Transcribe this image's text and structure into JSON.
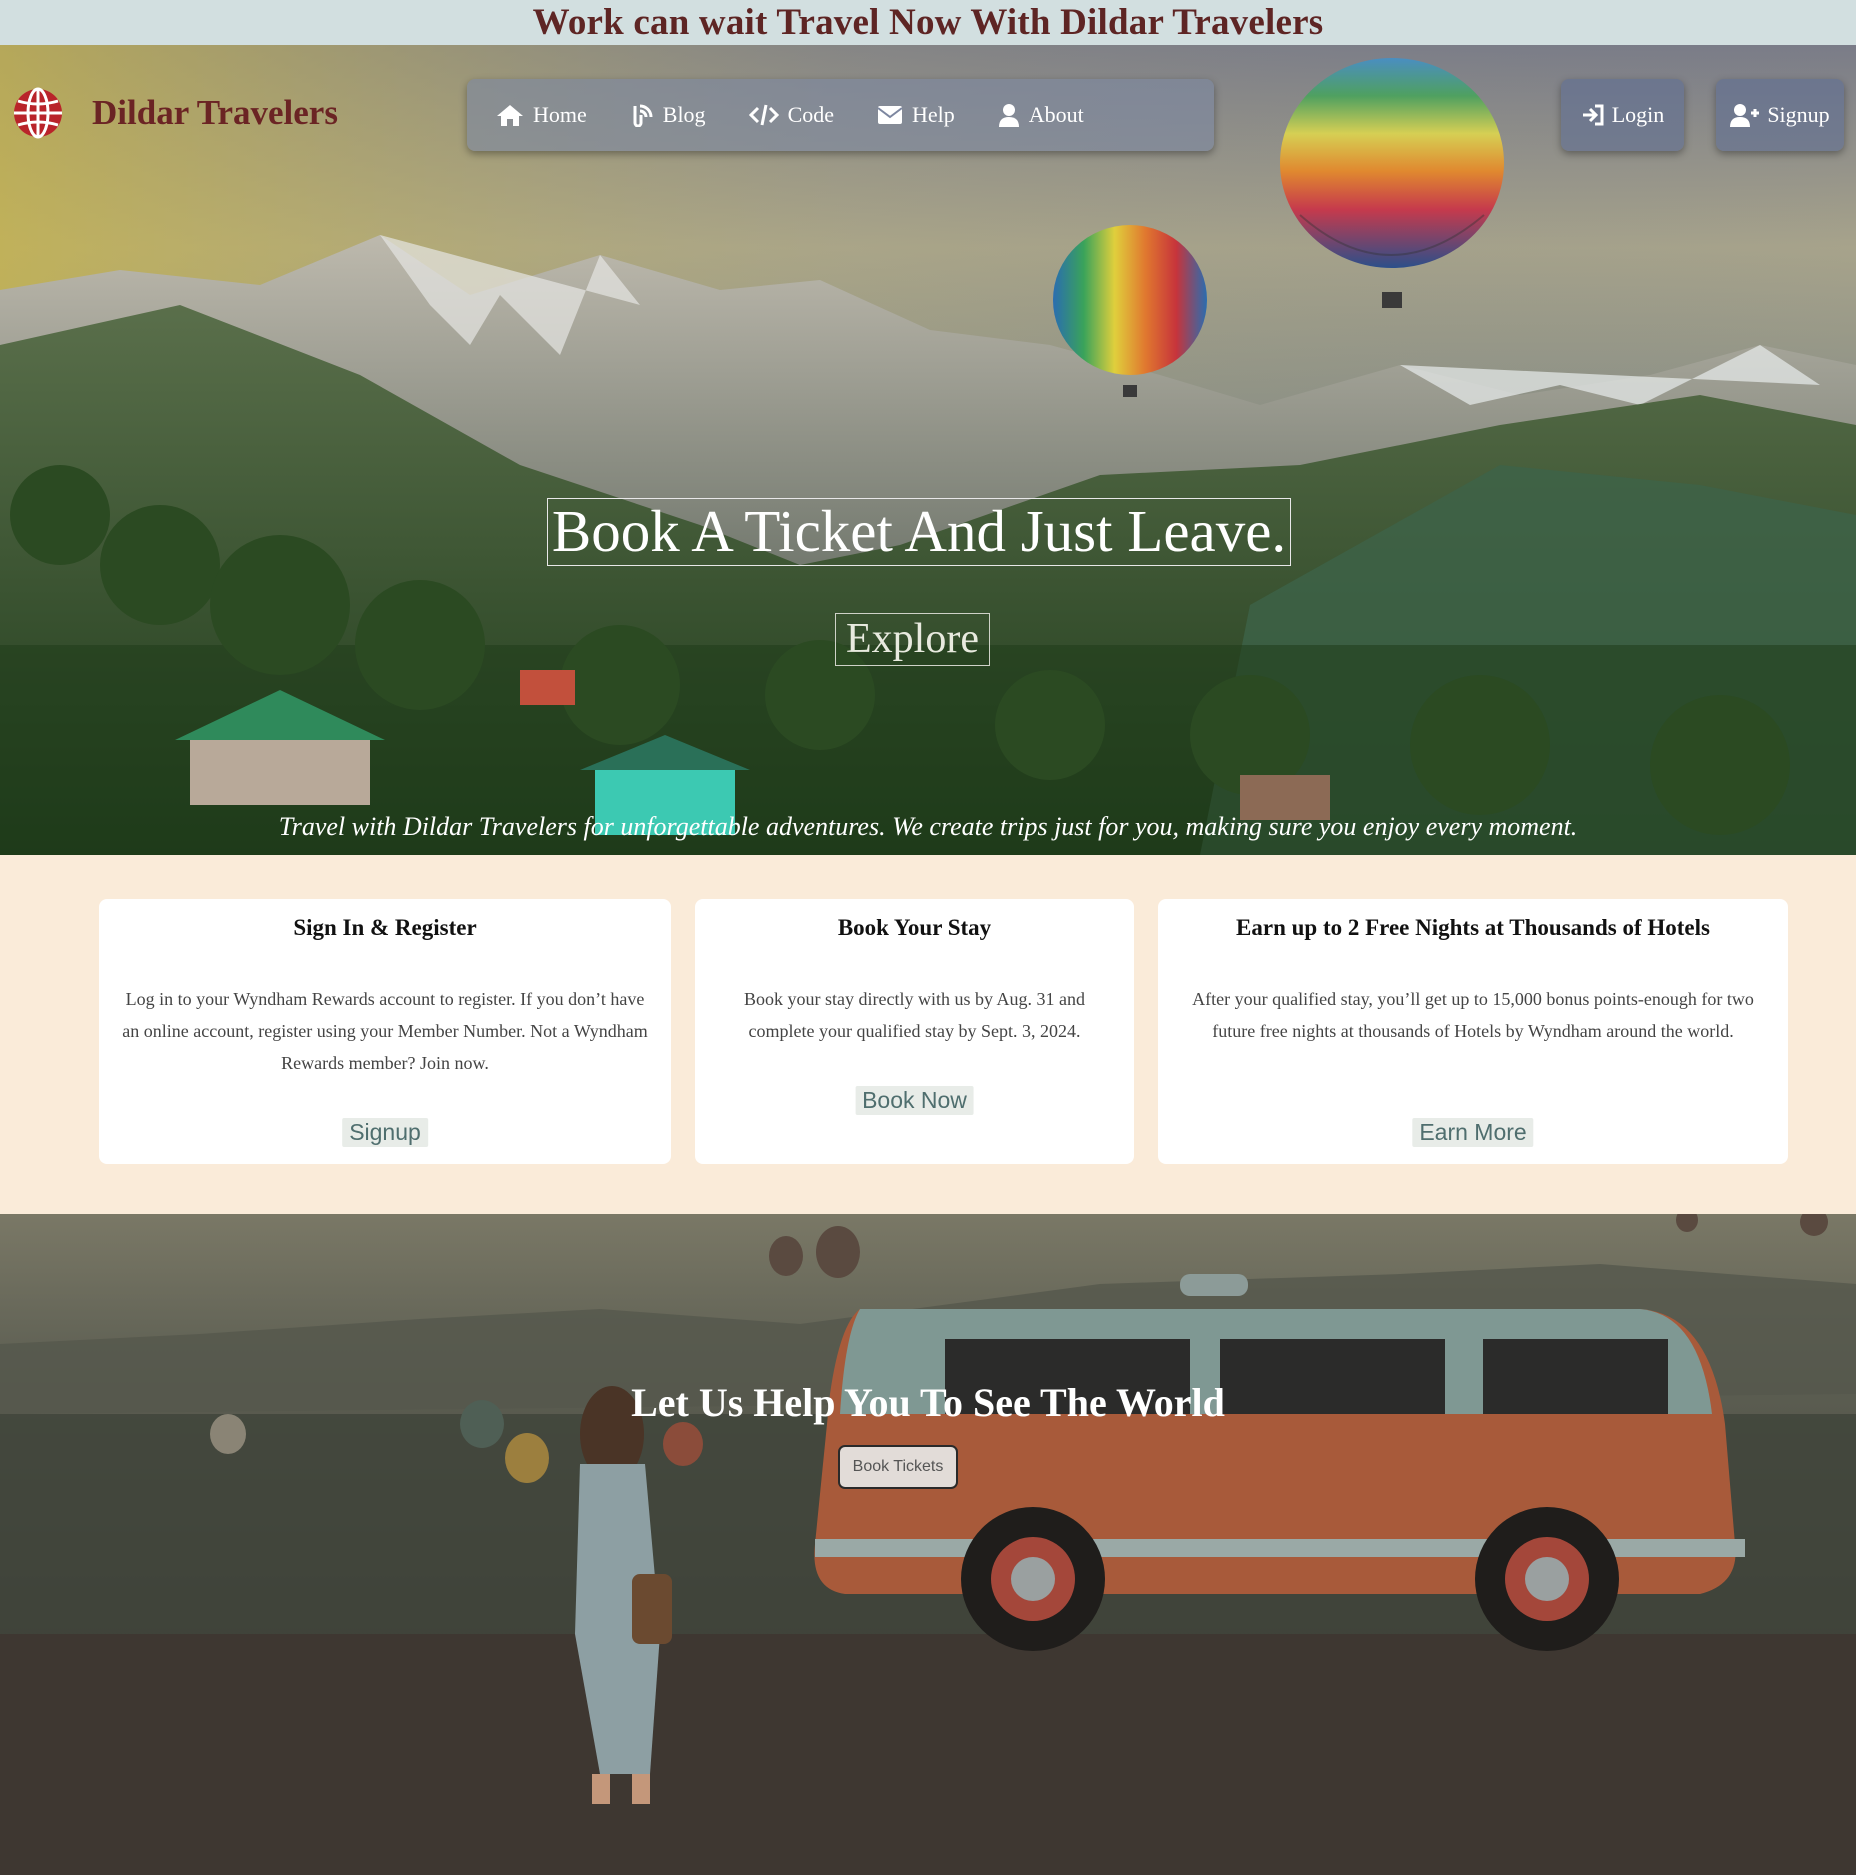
{
  "banner": {
    "text": "Work can wait Travel Now With Dildar Travelers"
  },
  "brand": {
    "name": "Dildar Travelers",
    "logo_icon": "globe-icon"
  },
  "nav": {
    "items": [
      {
        "label": "Home",
        "icon": "home-icon"
      },
      {
        "label": "Blog",
        "icon": "blog-icon"
      },
      {
        "label": "Code",
        "icon": "code-icon"
      },
      {
        "label": "Help",
        "icon": "envelope-icon"
      },
      {
        "label": "About",
        "icon": "user-icon"
      }
    ],
    "login": {
      "label": "Login",
      "icon": "sign-in-icon"
    },
    "signup": {
      "label": "Signup",
      "icon": "user-plus-icon"
    }
  },
  "hero": {
    "title": "Book A Ticket And Just Leave.",
    "explore_label": "Explore",
    "tagline": "Travel with Dildar Travelers for unforgettable adventures. We create trips just for you, making sure you enjoy every moment."
  },
  "cards": [
    {
      "title": "Sign In & Register",
      "body": "Log in to your Wyndham Rewards account to register. If you don’t have an online account, register using your Member Number. Not a Wyndham Rewards member? Join now.",
      "cta": "Signup"
    },
    {
      "title": "Book Your Stay",
      "body": "Book your stay directly with us by Aug. 31 and complete your qualified stay by Sept. 3, 2024.",
      "cta": "Book Now"
    },
    {
      "title": "Earn up to 2 Free Nights at Thousands of Hotels",
      "body": "After your qualified stay, you’ll get up to 15,000 bonus points-enough for two future free nights at thousands of Hotels by Wyndham around the world.",
      "cta": "Earn More"
    }
  ],
  "world": {
    "title": "Let Us Help You To See The World",
    "button_label": "Book Tickets"
  },
  "colors": {
    "brand": "#6b2424",
    "feature_bg": "#faebd9",
    "banner_bg": "#d2dfe0"
  }
}
